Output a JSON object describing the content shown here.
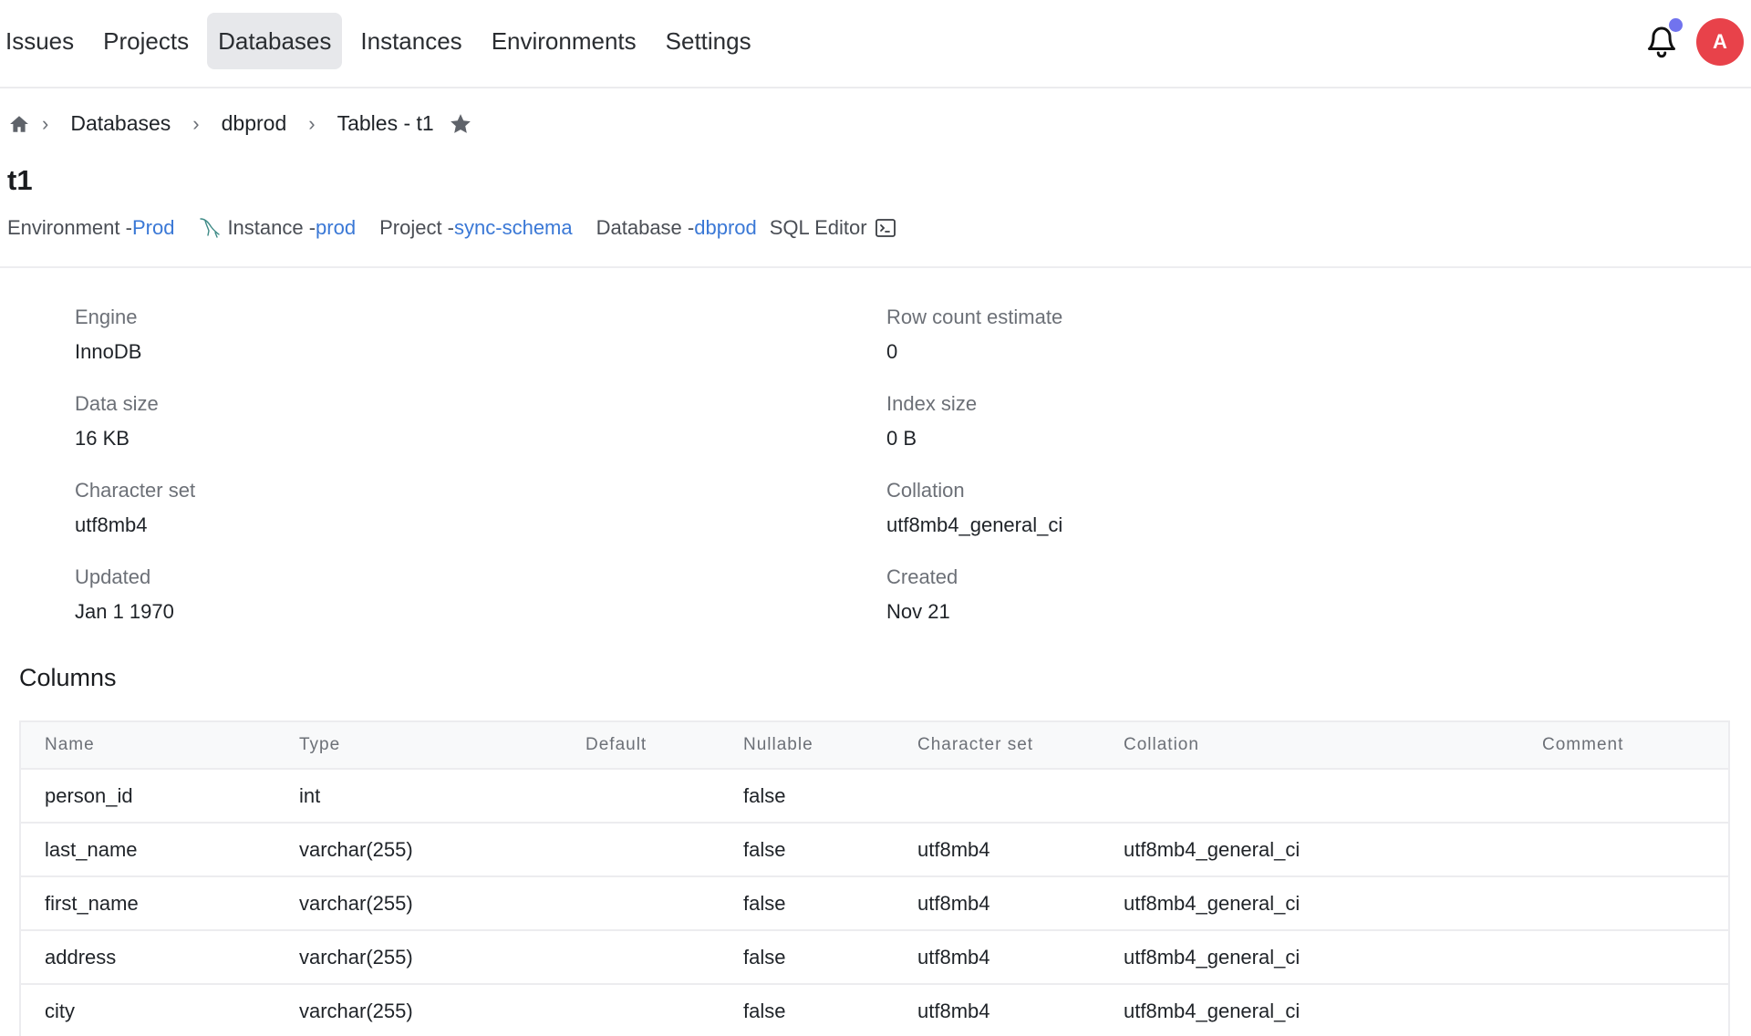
{
  "nav": {
    "items": [
      {
        "label": "Issues",
        "active": false
      },
      {
        "label": "Projects",
        "active": false
      },
      {
        "label": "Databases",
        "active": true
      },
      {
        "label": "Instances",
        "active": false
      },
      {
        "label": "Environments",
        "active": false
      },
      {
        "label": "Settings",
        "active": false
      }
    ],
    "notification_icon": "bell-icon",
    "has_unread_notifications": true,
    "avatar_initial": "A",
    "colors": {
      "avatar": "#e8424a",
      "notification_dot": "#7173ee",
      "link": "#3a78d6"
    }
  },
  "breadcrumb": {
    "home_icon": "home-icon",
    "items": [
      "Databases",
      "dbprod",
      "Tables - t1"
    ],
    "star_icon": "star-icon"
  },
  "page": {
    "title": "t1",
    "meta": {
      "environment_label": "Environment - ",
      "environment_value": "Prod",
      "instance_icon": "mysql-icon",
      "instance_label": "Instance - ",
      "instance_value": "prod",
      "project_label": "Project - ",
      "project_value": "sync-schema",
      "database_label": "Database - ",
      "database_value": "dbprod",
      "sql_editor_label": "SQL Editor",
      "sql_editor_icon": "terminal-icon"
    }
  },
  "info": {
    "left": [
      {
        "label": "Engine",
        "value": "InnoDB"
      },
      {
        "label": "Data size",
        "value": "16 KB"
      },
      {
        "label": "Character set",
        "value": "utf8mb4"
      },
      {
        "label": "Updated",
        "value": "Jan 1 1970"
      }
    ],
    "right": [
      {
        "label": "Row count estimate",
        "value": "0"
      },
      {
        "label": "Index size",
        "value": "0 B"
      },
      {
        "label": "Collation",
        "value": "utf8mb4_general_ci"
      },
      {
        "label": "Created",
        "value": "Nov 21"
      }
    ]
  },
  "columns": {
    "title": "Columns",
    "headers": {
      "name": "Name",
      "type": "Type",
      "default": "Default",
      "nullable": "Nullable",
      "charset": "Character set",
      "collation": "Collation",
      "comment": "Comment"
    },
    "rows": [
      {
        "name": "person_id",
        "type": "int",
        "default": "",
        "nullable": "false",
        "charset": "",
        "collation": "",
        "comment": ""
      },
      {
        "name": "last_name",
        "type": "varchar(255)",
        "default": "",
        "nullable": "false",
        "charset": "utf8mb4",
        "collation": "utf8mb4_general_ci",
        "comment": ""
      },
      {
        "name": "first_name",
        "type": "varchar(255)",
        "default": "",
        "nullable": "false",
        "charset": "utf8mb4",
        "collation": "utf8mb4_general_ci",
        "comment": ""
      },
      {
        "name": "address",
        "type": "varchar(255)",
        "default": "",
        "nullable": "false",
        "charset": "utf8mb4",
        "collation": "utf8mb4_general_ci",
        "comment": ""
      },
      {
        "name": "city",
        "type": "varchar(255)",
        "default": "",
        "nullable": "false",
        "charset": "utf8mb4",
        "collation": "utf8mb4_general_ci",
        "comment": ""
      }
    ]
  }
}
